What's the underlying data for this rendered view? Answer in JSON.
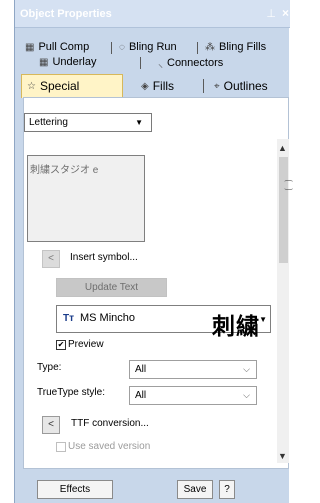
{
  "window": {
    "title": "Object Properties",
    "pin_glyph": "ᵖ",
    "close_glyph": "×"
  },
  "tabs": {
    "row1": [
      {
        "label": "Pull Comp",
        "icon": "pull-comp-icon"
      },
      {
        "label": "Bling Run",
        "icon": "bling-run-icon"
      },
      {
        "label": "Bling Fills",
        "icon": "bling-fills-icon"
      }
    ],
    "row2": [
      {
        "label": "Underlay",
        "icon": "underlay-icon"
      },
      {
        "label": "Connectors",
        "icon": "connectors-icon"
      }
    ],
    "row3": [
      {
        "label": "Special",
        "icon": "star-icon",
        "active": true
      },
      {
        "label": "Fills",
        "icon": "fills-icon"
      },
      {
        "label": "Outlines",
        "icon": "outlines-icon"
      }
    ]
  },
  "lettering_dropdown": {
    "selected": "Lettering"
  },
  "text_area": {
    "value": "刺繍スタジオ e"
  },
  "insert_symbol": {
    "label": "Insert symbol..."
  },
  "update_text": {
    "label": "Update Text"
  },
  "font": {
    "icon_text": "Tт",
    "name": "MS Mincho",
    "preview": "刺繍"
  },
  "preview_checkbox": {
    "label": "Preview",
    "checked": true
  },
  "type_field": {
    "label": "Type:",
    "value": "All"
  },
  "truetype_style": {
    "label": "TrueType style:",
    "value": "All"
  },
  "ttf_conversion": {
    "label": "TTF conversion..."
  },
  "use_saved_version": {
    "label": "Use saved version",
    "checked": false
  },
  "footer": {
    "effects": "Effects",
    "save": "Save",
    "help": "?"
  },
  "colors": {
    "panel_bg": "#c8d7ea",
    "active_tab": "#fff4c7"
  }
}
